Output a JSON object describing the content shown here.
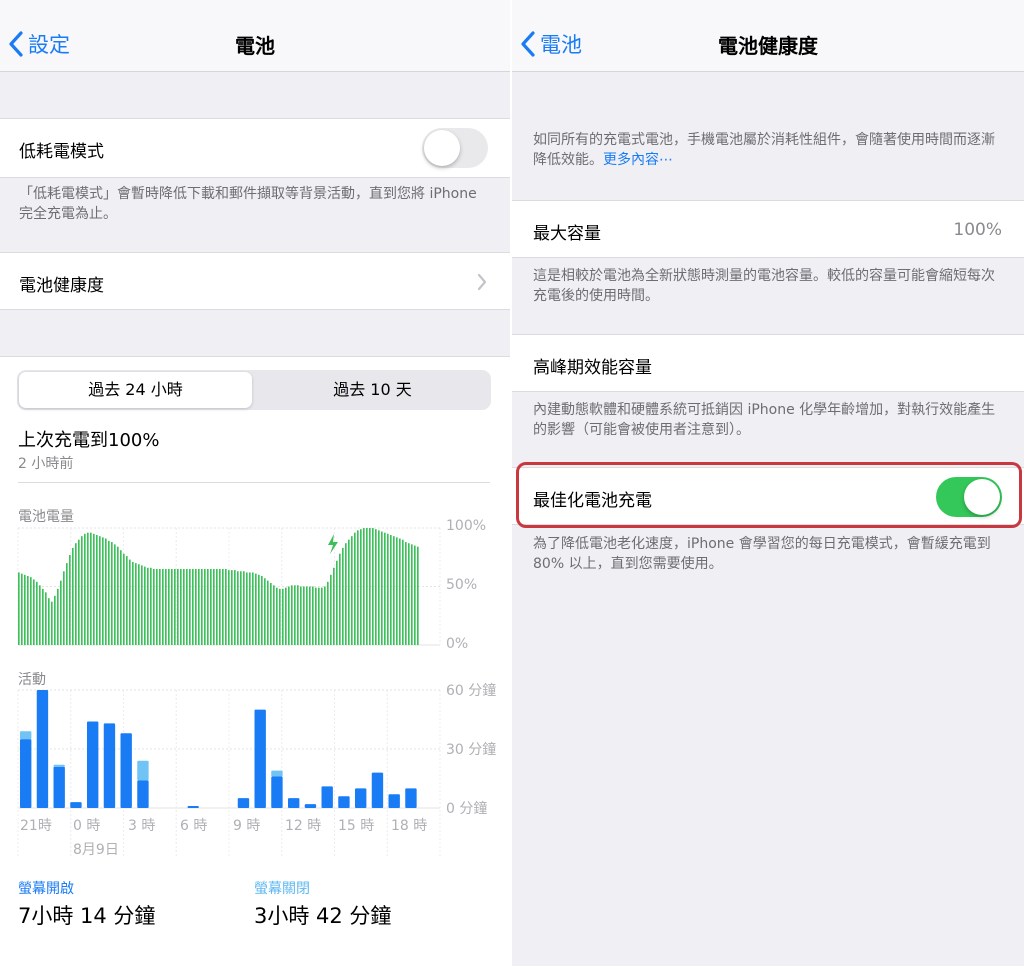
{
  "left": {
    "nav": {
      "back_label": "設定",
      "title": "電池"
    },
    "low_power": {
      "label": "低耗電模式",
      "enabled": false,
      "footer": "「低耗電模式」會暫時降低下載和郵件擷取等背景活動，直到您將 iPhone完全充電為止。"
    },
    "battery_health_link": "電池健康度",
    "segments": {
      "option_24h": "過去 24 小時",
      "option_10d": "過去 10 天",
      "selected": "option_24h"
    },
    "last_charge": {
      "title": "上次充電到100%",
      "subtitle": "2 小時前"
    },
    "battery_chart": {
      "label": "電池電量",
      "y_ticks": [
        "100%",
        "50%",
        "0%"
      ]
    },
    "activity_chart": {
      "label": "活動",
      "y_ticks": [
        "60 分鐘",
        "30 分鐘",
        "0 分鐘"
      ],
      "x_ticks": [
        "21時",
        "0 時",
        "3 時",
        "6 時",
        "9 時",
        "12 時",
        "15 時",
        "18 時"
      ],
      "date_label": "8月9日"
    },
    "summary": {
      "screen_on_label": "螢幕開啟",
      "screen_on_value": "7小時 14 分鐘",
      "screen_off_label": "螢幕關閉",
      "screen_off_value": "3小時 42 分鐘"
    }
  },
  "right": {
    "nav": {
      "back_label": "電池",
      "title": "電池健康度"
    },
    "intro": "如同所有的充電式電池，手機電池屬於消耗性組件，會隨著使用時間而逐漸降低效能。",
    "intro_link": "更多內容⋯",
    "max_capacity": {
      "label": "最大容量",
      "value": "100%",
      "footer": "這是相較於電池為全新狀態時測量的電池容量。較低的容量可能會縮短每次充電後的使用時間。"
    },
    "peak_performance": {
      "label": "高峰期效能容量",
      "footer": "內建動態軟體和硬體系統可抵銷因 iPhone 化學年齡增加，對執行效能產生的影響（可能會被使用者注意到）。"
    },
    "optimized_charging": {
      "label": "最佳化電池充電",
      "enabled": true,
      "footer": "為了降低電池老化速度，iPhone 會學習您的每日充電模式，會暫緩充電到 80% 以上，直到您需要使用。"
    }
  },
  "colors": {
    "accent_blue": "#1a7cf5",
    "battery_green": "#3dbf59",
    "activity_blue": "#1a7cf5",
    "activity_light_blue": "#6fc4f5",
    "toggle_green": "#34c759",
    "highlight_red": "#c9383e"
  },
  "chart_data": [
    {
      "type": "bar",
      "title": "電池電量",
      "ylim": [
        0,
        100
      ],
      "y_ticks": [
        "100%",
        "50%",
        "0%"
      ],
      "values": [
        62,
        61,
        60,
        59,
        58,
        56,
        54,
        51,
        48,
        45,
        40,
        37,
        42,
        48,
        55,
        63,
        70,
        77,
        83,
        87,
        90,
        93,
        95,
        96,
        96,
        95,
        94,
        93,
        92,
        91,
        89,
        88,
        86,
        84,
        81,
        78,
        76,
        73,
        71,
        70,
        69,
        68,
        67,
        66,
        66,
        65,
        65,
        65,
        65,
        65,
        65,
        65,
        65,
        65,
        65,
        65,
        65,
        65,
        65,
        65,
        65,
        65,
        65,
        65,
        65,
        65,
        65,
        65,
        65,
        65,
        64,
        64,
        64,
        63,
        63,
        63,
        62,
        62,
        62,
        61,
        60,
        59,
        57,
        55,
        53,
        51,
        49,
        48,
        48,
        49,
        50,
        51,
        51,
        51,
        50,
        50,
        50,
        50,
        50,
        49,
        49,
        49,
        50,
        54,
        60,
        66,
        72,
        78,
        83,
        87,
        90,
        93,
        96,
        98,
        99,
        100,
        100,
        100,
        100,
        99,
        98,
        97,
        96,
        95,
        94,
        93,
        92,
        91,
        90,
        88,
        87,
        86,
        85,
        84
      ]
    },
    {
      "type": "bar",
      "title": "活動",
      "ylim": [
        0,
        60
      ],
      "x_ticks": [
        "21時",
        "0 時",
        "3 時",
        "6 時",
        "9 時",
        "12 時",
        "15 時",
        "18 時"
      ],
      "series": [
        {
          "values": [
            35,
            60,
            21,
            3,
            44,
            43,
            38,
            14,
            0,
            0,
            1,
            0,
            0,
            5,
            50,
            16,
            5,
            2,
            11,
            6,
            10,
            18,
            7,
            10
          ]
        },
        {
          "values": [
            4,
            0,
            1,
            0,
            0,
            0,
            0,
            10,
            0,
            0,
            0,
            0,
            0,
            0,
            0,
            3,
            0,
            0,
            0,
            0,
            0,
            0,
            0,
            0
          ]
        }
      ]
    }
  ]
}
